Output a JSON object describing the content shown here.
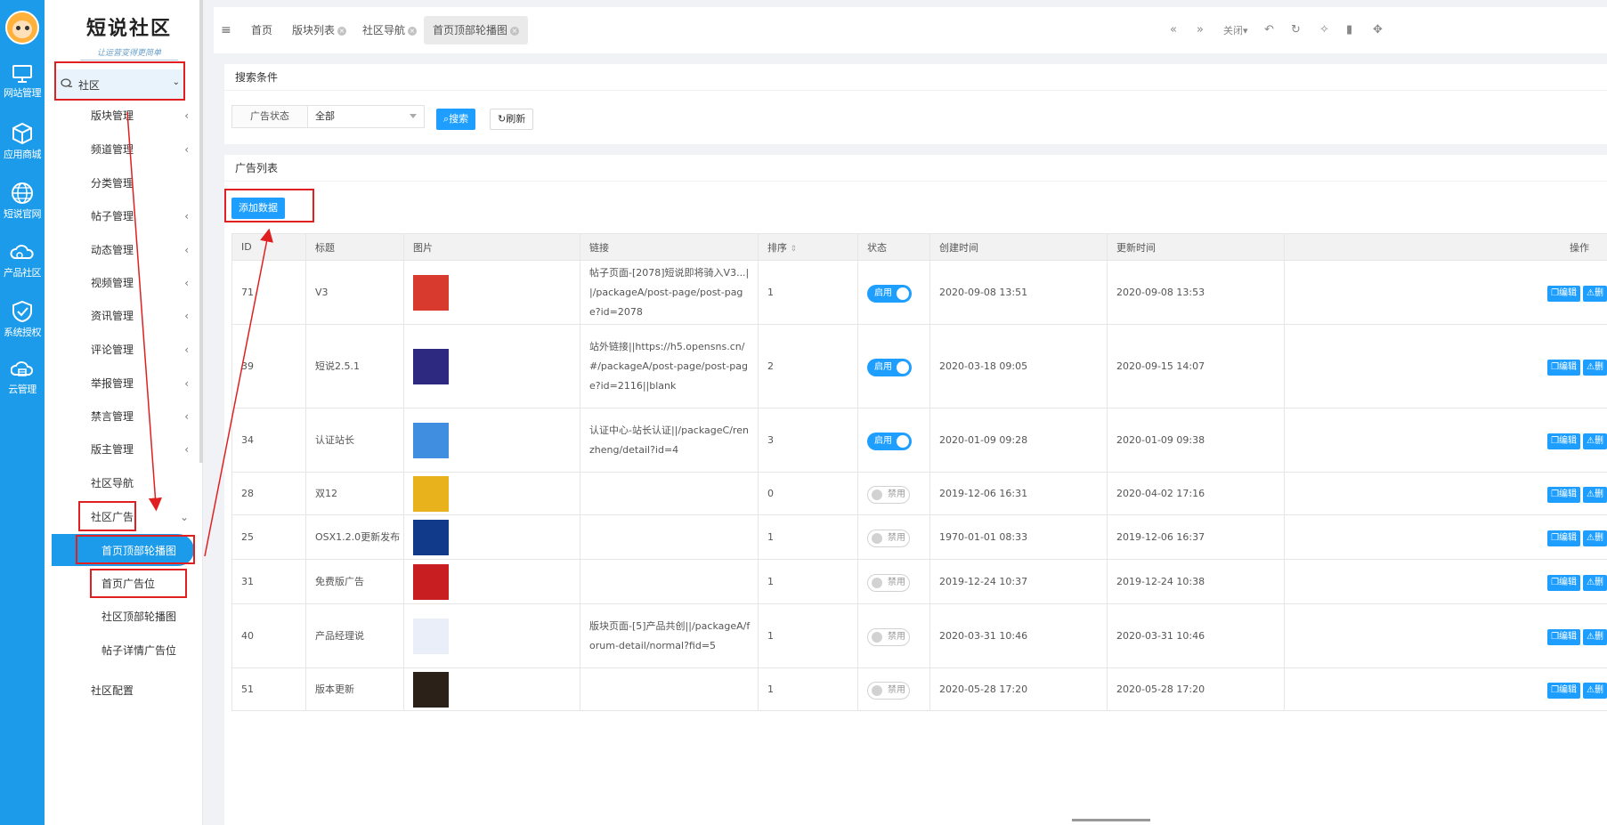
{
  "rail": {
    "items": [
      {
        "label": "网站管理",
        "icon": "monitor-icon"
      },
      {
        "label": "应用商城",
        "icon": "cube-icon"
      },
      {
        "label": "短说官网",
        "icon": "globe-icon"
      },
      {
        "label": "产品社区",
        "icon": "cloud-icon"
      },
      {
        "label": "系统授权",
        "icon": "shield-check-icon"
      },
      {
        "label": "云管理",
        "icon": "cloud-server-icon"
      }
    ]
  },
  "sidebar": {
    "logo_title": "短说社区",
    "logo_sub": "让运营变得更简单",
    "top_item": "社区",
    "items": [
      {
        "label": "版块管理",
        "arrow": "‹"
      },
      {
        "label": "频道管理",
        "arrow": "‹"
      },
      {
        "label": "分类管理",
        "arrow": ""
      },
      {
        "label": "帖子管理",
        "arrow": "‹"
      },
      {
        "label": "动态管理",
        "arrow": "‹"
      },
      {
        "label": "视频管理",
        "arrow": "‹"
      },
      {
        "label": "资讯管理",
        "arrow": "‹"
      },
      {
        "label": "评论管理",
        "arrow": "‹"
      },
      {
        "label": "举报管理",
        "arrow": "‹"
      },
      {
        "label": "禁言管理",
        "arrow": "‹"
      },
      {
        "label": "版主管理",
        "arrow": "‹"
      },
      {
        "label": "社区导航",
        "arrow": ""
      },
      {
        "label": "社区广告",
        "arrow": "⌄"
      }
    ],
    "sub_items": [
      {
        "label": "首页顶部轮播图"
      },
      {
        "label": "首页广告位"
      },
      {
        "label": "社区顶部轮播图"
      },
      {
        "label": "帖子详情广告位"
      }
    ],
    "config_item": "社区配置"
  },
  "tabs": [
    {
      "label": "首页",
      "closable": false
    },
    {
      "label": "版块列表",
      "closable": true
    },
    {
      "label": "社区导航",
      "closable": true
    },
    {
      "label": "首页顶部轮播图",
      "closable": true
    }
  ],
  "toolbar": {
    "close_label": "关闭"
  },
  "search": {
    "header": "搜索条件",
    "status_label": "广告状态",
    "status_value": "全部",
    "search_button": "搜索",
    "refresh_button": "刷新"
  },
  "list": {
    "header": "广告列表",
    "add_button": "添加数据",
    "columns": [
      "ID",
      "标题",
      "图片",
      "链接",
      "排序",
      "状态",
      "创建时间",
      "更新时间",
      "操作"
    ],
    "edit_label": "编辑",
    "delete_label": "删",
    "rows": [
      {
        "id": "71",
        "title": "V3",
        "thumb": "#d83a2e",
        "link": "帖子页面-[2078]短说即将骑入V3...||/packageA/post-page/post-page?id=2078",
        "sort": "1",
        "status": "启用",
        "on": true,
        "created": "2020-09-08 13:51",
        "updated": "2020-09-08 13:53"
      },
      {
        "id": "39",
        "title": "短说2.5.1",
        "thumb": "#2d2880",
        "link": "站外链接||https://h5.opensns.cn/#/packageA/post-page/post-page?id=2116||blank",
        "sort": "2",
        "status": "启用",
        "on": true,
        "created": "2020-03-18 09:05",
        "updated": "2020-09-15 14:07"
      },
      {
        "id": "34",
        "title": "认证站长",
        "thumb": "#3f8ee0",
        "link": "认证中心-站长认证||/packageC/renzheng/detail?id=4",
        "sort": "3",
        "status": "启用",
        "on": true,
        "created": "2020-01-09 09:28",
        "updated": "2020-01-09 09:38"
      },
      {
        "id": "28",
        "title": "双12",
        "thumb": "#e8b21c",
        "link": "",
        "sort": "0",
        "status": "禁用",
        "on": false,
        "created": "2019-12-06 16:31",
        "updated": "2020-04-02 17:16"
      },
      {
        "id": "25",
        "title": "OSX1.2.0更新发布",
        "thumb": "#123a8a",
        "link": "",
        "sort": "1",
        "status": "禁用",
        "on": false,
        "created": "1970-01-01 08:33",
        "updated": "2019-12-06 16:37"
      },
      {
        "id": "31",
        "title": "免费版广告",
        "thumb": "#c81e22",
        "link": "",
        "sort": "1",
        "status": "禁用",
        "on": false,
        "created": "2019-12-24 10:37",
        "updated": "2019-12-24 10:38"
      },
      {
        "id": "40",
        "title": "产品经理说",
        "thumb": "#e9eef9",
        "link": "版块页面-[5]产品共创||/packageA/forum-detail/normal?fid=5",
        "sort": "1",
        "status": "禁用",
        "on": false,
        "created": "2020-03-31 10:46",
        "updated": "2020-03-31 10:46"
      },
      {
        "id": "51",
        "title": "版本更新",
        "thumb": "#2b2118",
        "link": "",
        "sort": "1",
        "status": "禁用",
        "on": false,
        "created": "2020-05-28 17:20",
        "updated": "2020-05-28 17:20"
      }
    ]
  }
}
